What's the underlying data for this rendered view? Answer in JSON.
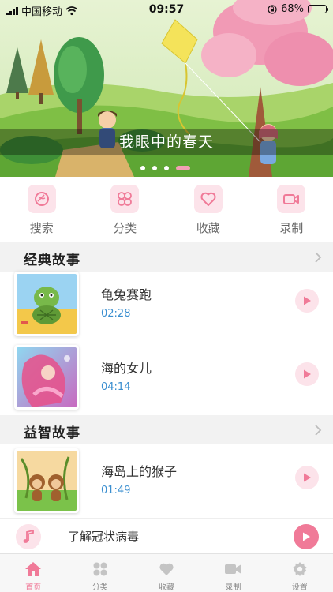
{
  "status_bar": {
    "carrier": "中国移动",
    "time": "09:57",
    "battery": "68%",
    "battery_level": 0.68
  },
  "banner": {
    "caption": "我眼中的春天",
    "page_count": 4,
    "active_index": 3
  },
  "quick_nav": [
    {
      "label": "搜索",
      "icon": "search-icon"
    },
    {
      "label": "分类",
      "icon": "category-icon"
    },
    {
      "label": "收藏",
      "icon": "heart-icon"
    },
    {
      "label": "录制",
      "icon": "video-camera-icon"
    }
  ],
  "sections": [
    {
      "title": "经典故事",
      "items": [
        {
          "name": "龟兔赛跑",
          "duration": "02:28"
        },
        {
          "name": "海的女儿",
          "duration": "04:14"
        }
      ]
    },
    {
      "title": "益智故事",
      "items": [
        {
          "name": "海岛上的猴子",
          "duration": "01:49"
        }
      ]
    }
  ],
  "player": {
    "title": "了解冠状病毒"
  },
  "tab_bar": [
    {
      "label": "首页",
      "icon": "home-icon",
      "active": true
    },
    {
      "label": "分类",
      "icon": "category-icon",
      "active": false
    },
    {
      "label": "收藏",
      "icon": "heart-icon",
      "active": false
    },
    {
      "label": "录制",
      "icon": "video-camera-icon",
      "active": false
    },
    {
      "label": "设置",
      "icon": "gear-icon",
      "active": false
    }
  ],
  "colors": {
    "accent": "#f07a98",
    "accent_light": "#fce3ea",
    "duration_blue": "#3b8fd0",
    "section_bg": "#f2f2f2"
  }
}
